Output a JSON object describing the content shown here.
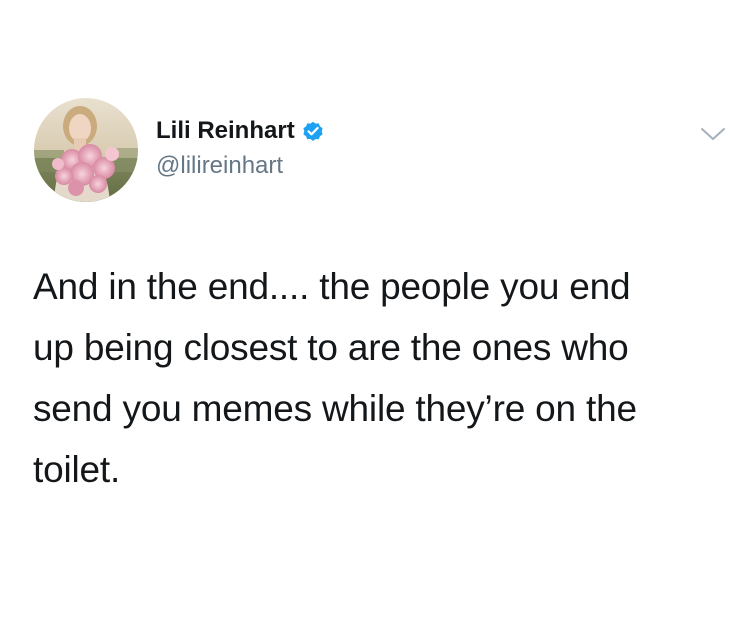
{
  "author": {
    "display_name": "Lili Reinhart",
    "handle": "@lilireinhart",
    "verified": true,
    "verified_color": "#1da1f2",
    "avatar_icon": "profile-photo-with-pink-flowers"
  },
  "menu": {
    "icon": "chevron-down-icon"
  },
  "tweet": {
    "lines": [
      "And in the end.... the people you end",
      "up being closest to are the ones who",
      "send you memes while they’re on the",
      "toilet."
    ]
  },
  "colors": {
    "text": "#14171a",
    "secondary_text": "#657786",
    "background": "#ffffff"
  }
}
